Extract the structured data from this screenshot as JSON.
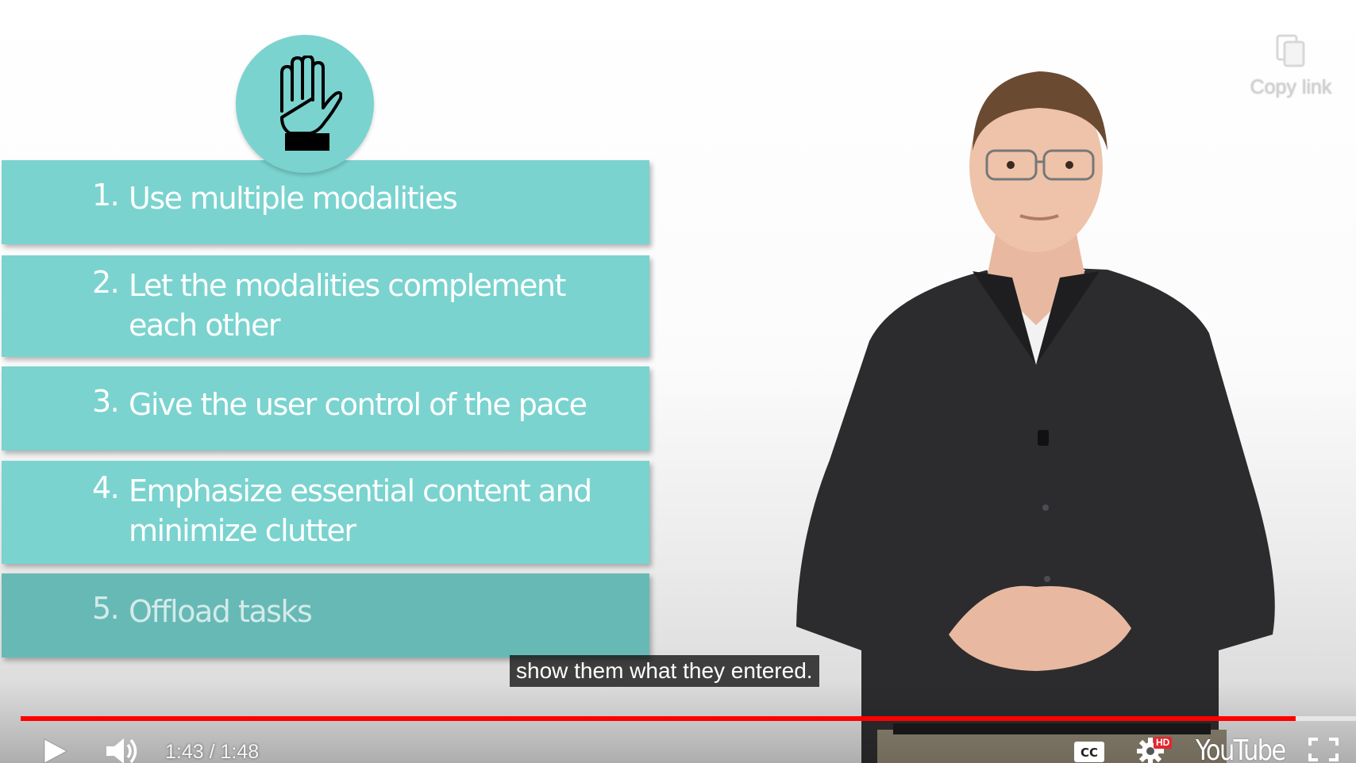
{
  "slide": {
    "items": [
      {
        "number": "1.",
        "lines": [
          "Use multiple modalities"
        ]
      },
      {
        "number": "2.",
        "lines": [
          "Let the modalities complement",
          "each other"
        ]
      },
      {
        "number": "3.",
        "lines": [
          "Give the user control of the pace"
        ]
      },
      {
        "number": "4.",
        "lines": [
          "Emphasize essential content and",
          "minimize clutter"
        ]
      },
      {
        "number": "5.",
        "lines": [
          "Offload tasks"
        ]
      }
    ],
    "icon": "raised-hand-icon"
  },
  "copy_link": {
    "label": "Copy link",
    "icon": "copy-link-icon"
  },
  "caption": "show them what they entered.",
  "player": {
    "current_time": "1:43",
    "duration": "1:48",
    "time_display": "1:43 / 1:48",
    "progress": 0.955,
    "hd_badge": "HD",
    "logo": "YouTube",
    "colors": {
      "accent": "#ff0000",
      "slide_teal": "#7ad3cf",
      "hd_red": "#e4272f"
    }
  }
}
